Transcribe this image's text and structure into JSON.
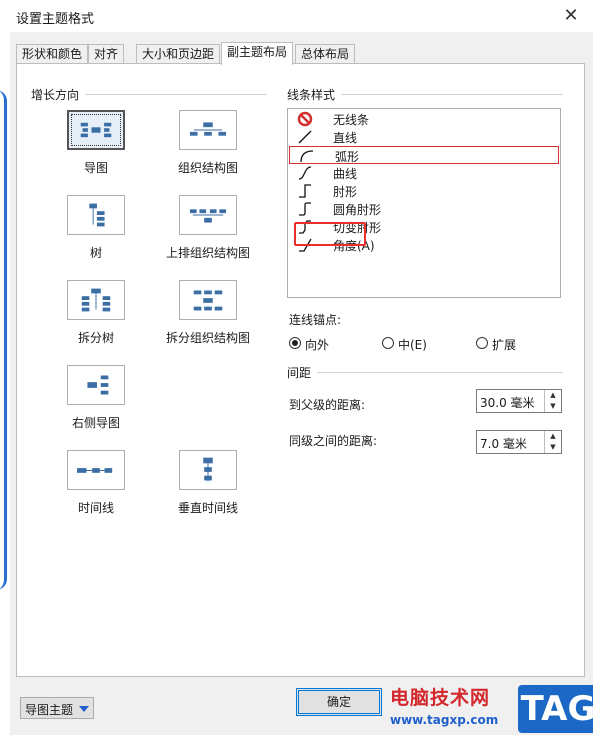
{
  "window": {
    "title": "设置主题格式"
  },
  "tabs": [
    {
      "label": "形状和颜色",
      "active": false
    },
    {
      "label": "对齐",
      "active": false
    },
    {
      "label": "大小和页边距",
      "active": false
    },
    {
      "label": "副主题布局",
      "active": true
    },
    {
      "label": "总体布局",
      "active": false
    }
  ],
  "growth": {
    "header": "增长方向",
    "layouts": [
      {
        "label": "导图",
        "icon": "mind-map-layout-icon",
        "selected": true
      },
      {
        "label": "组织结构图",
        "icon": "org-chart-layout-icon",
        "selected": false
      },
      {
        "label": "树",
        "icon": "tree-layout-icon",
        "selected": false
      },
      {
        "label": "上排组织结构图",
        "icon": "top-org-chart-layout-icon",
        "selected": false
      },
      {
        "label": "拆分树",
        "icon": "split-tree-layout-icon",
        "selected": false
      },
      {
        "label": "拆分组织结构图",
        "icon": "split-org-chart-layout-icon",
        "selected": false
      },
      {
        "label": "右侧导图",
        "icon": "right-map-layout-icon",
        "selected": false
      },
      {
        "label": "时间线",
        "icon": "timeline-layout-icon",
        "selected": false
      },
      {
        "label": "垂直时间线",
        "icon": "vertical-timeline-layout-icon",
        "selected": false
      }
    ]
  },
  "line_style": {
    "header": "线条样式",
    "items": [
      {
        "label": "无线条",
        "icon": "no-line-icon"
      },
      {
        "label": "直线",
        "icon": "straight-line-icon"
      },
      {
        "label": "弧形",
        "icon": "arc-line-icon"
      },
      {
        "label": "曲线",
        "icon": "curve-line-icon"
      },
      {
        "label": "肘形",
        "icon": "elbow-line-icon"
      },
      {
        "label": "圆角肘形",
        "icon": "rounded-elbow-line-icon"
      },
      {
        "label": "切变肘形",
        "icon": "bevel-elbow-line-icon"
      },
      {
        "label": "角度(A)",
        "icon": "angle-line-icon"
      }
    ],
    "focused_index": 2,
    "highlighted_label": "曲线"
  },
  "anchor": {
    "label": "连线锚点:",
    "options": [
      {
        "label": "向外",
        "checked": true
      },
      {
        "label": "中(E)",
        "checked": false
      },
      {
        "label": "扩展",
        "checked": false
      }
    ]
  },
  "spacing": {
    "header": "间距",
    "parent_label": "到父级的距离:",
    "parent_value": "30.0 毫米",
    "sibling_label": "同级之间的距离:",
    "sibling_value": "7.0 毫米"
  },
  "footer": {
    "dropdown_label": "导图主题",
    "ok_label": "确定"
  },
  "watermark": {
    "text": "电脑技术网",
    "url": "www.tagxp.com",
    "tag": "TAG"
  },
  "colors": {
    "accent": "#0078d7",
    "highlight_red": "#e8312f",
    "icon_blue": "#3a6ea5"
  }
}
